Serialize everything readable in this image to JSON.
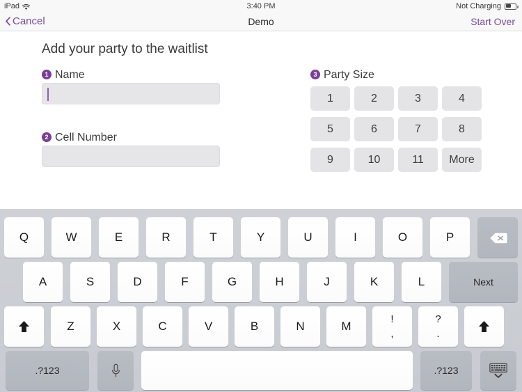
{
  "status_bar": {
    "device": "iPad",
    "wifi_icon": "wifi-icon",
    "time": "3:40 PM",
    "battery_label": "Not Charging",
    "battery_icon": "battery-icon"
  },
  "nav_bar": {
    "back_icon": "chevron-left-icon",
    "cancel_label": "Cancel",
    "title": "Demo",
    "start_over_label": "Start Over",
    "tint_color": "#7a4b9e"
  },
  "main": {
    "page_title": "Add your party to the waitlist",
    "fields": [
      {
        "badge": "1",
        "label": "Name",
        "value": "",
        "placeholder": "",
        "focused": true
      },
      {
        "badge": "2",
        "label": "Cell Number",
        "value": "",
        "placeholder": "",
        "focused": false
      }
    ],
    "party_size": {
      "badge": "3",
      "label": "Party Size",
      "options": [
        "1",
        "2",
        "3",
        "4",
        "5",
        "6",
        "7",
        "8",
        "9",
        "10",
        "11",
        "More"
      ]
    },
    "next_label": "Next",
    "next_icon": "chevron-right-icon"
  },
  "keyboard": {
    "row1": [
      "Q",
      "W",
      "E",
      "R",
      "T",
      "Y",
      "U",
      "I",
      "O",
      "P"
    ],
    "row1_special": {
      "name": "delete-key",
      "icon": "backspace-icon"
    },
    "row2": [
      "A",
      "S",
      "D",
      "F",
      "G",
      "H",
      "J",
      "K",
      "L"
    ],
    "row2_special": {
      "name": "return-key",
      "label": "Next"
    },
    "row3_shift_left": {
      "name": "shift-key-left",
      "icon": "shift-arrow-icon"
    },
    "row3": [
      "Z",
      "X",
      "C",
      "V",
      "B",
      "N",
      "M"
    ],
    "row3_punct": [
      {
        "top": "!",
        "bottom": ","
      },
      {
        "top": "?",
        "bottom": "."
      }
    ],
    "row3_shift_right": {
      "name": "shift-key-right",
      "icon": "shift-arrow-icon"
    },
    "row4": {
      "numeric_left": ".?123",
      "dictation_icon": "microphone-icon",
      "space_label": "",
      "numeric_right": ".?123",
      "hide_icon": "hide-keyboard-icon"
    }
  }
}
